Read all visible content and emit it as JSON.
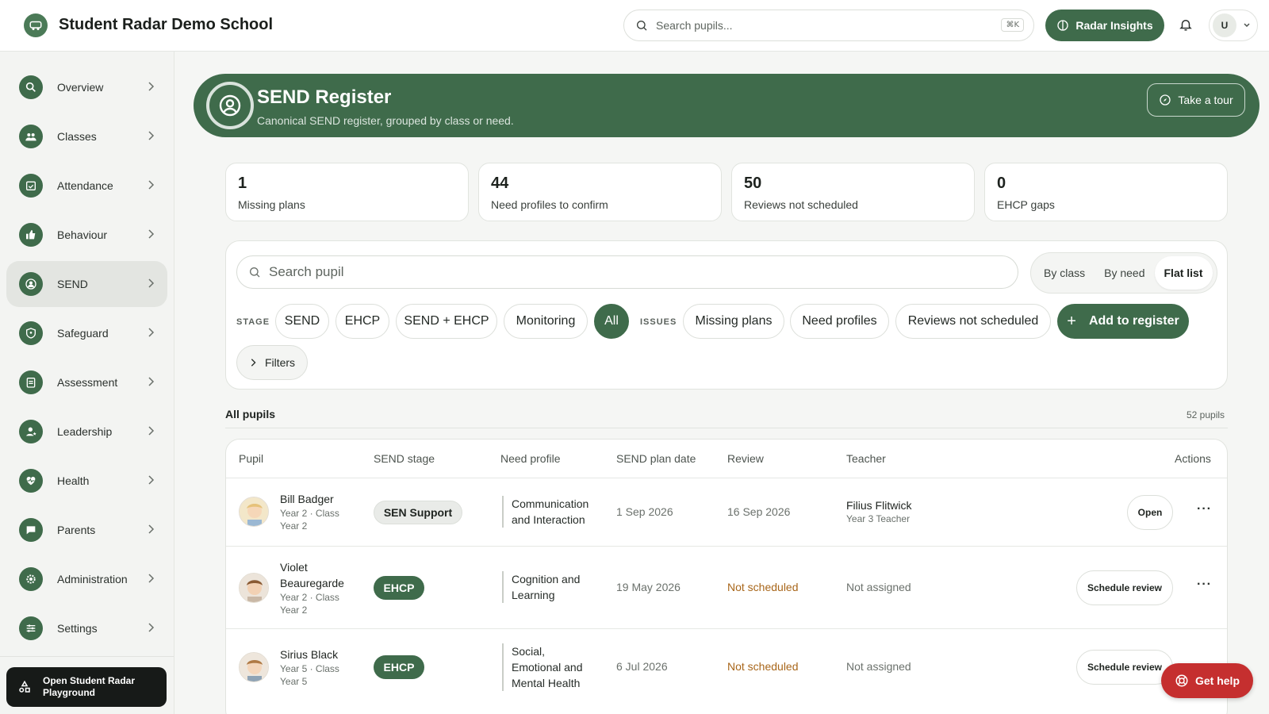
{
  "header": {
    "school_name": "Student Radar Demo School",
    "search_placeholder": "Search pupils...",
    "shortcut": "⌘K",
    "insights_label": "Radar Insights",
    "avatar_initial": "U"
  },
  "sidebar": {
    "items": [
      {
        "label": "Overview",
        "icon": "search-icon"
      },
      {
        "label": "Classes",
        "icon": "users-icon"
      },
      {
        "label": "Attendance",
        "icon": "calendar-check-icon"
      },
      {
        "label": "Behaviour",
        "icon": "thumbs-up-icon"
      },
      {
        "label": "SEND",
        "icon": "user-circle-icon",
        "active": true
      },
      {
        "label": "Safeguard",
        "icon": "shield-icon"
      },
      {
        "label": "Assessment",
        "icon": "clipboard-icon"
      },
      {
        "label": "Leadership",
        "icon": "user-star-icon"
      },
      {
        "label": "Health",
        "icon": "heart-pulse-icon"
      },
      {
        "label": "Parents",
        "icon": "chat-icon"
      },
      {
        "label": "Administration",
        "icon": "gear-icon"
      },
      {
        "label": "Settings",
        "icon": "sliders-icon"
      }
    ],
    "playground_label": "Open Student Radar Playground"
  },
  "banner": {
    "title": "SEND Register",
    "subtitle": "Canonical SEND register, grouped by class or need.",
    "tour_label": "Take a tour"
  },
  "stats": [
    {
      "value": "1",
      "label": "Missing plans"
    },
    {
      "value": "44",
      "label": "Need profiles to confirm"
    },
    {
      "value": "50",
      "label": "Reviews not scheduled"
    },
    {
      "value": "0",
      "label": "EHCP gaps"
    }
  ],
  "filters": {
    "search_placeholder": "Search pupil",
    "views": [
      "By class",
      "By need",
      "Flat list"
    ],
    "selected_view": "Flat list",
    "stage_label": "STAGE",
    "stages": [
      "SEND",
      "EHCP",
      "SEND + EHCP",
      "Monitoring",
      "All"
    ],
    "selected_stage": "All",
    "issues_label": "ISSUES",
    "issues": [
      "Missing plans",
      "Need profiles",
      "Reviews not scheduled"
    ],
    "add_label": "Add to register",
    "filters_label": "Filters"
  },
  "list": {
    "title": "All pupils",
    "count": "52 pupils",
    "columns": [
      "Pupil",
      "SEND stage",
      "Need profile",
      "SEND plan date",
      "Review",
      "Teacher",
      "Actions"
    ],
    "rows": [
      {
        "name": "Bill Badger",
        "meta1": "Year 2 · Class",
        "meta2": "Year 2",
        "stage": "SEN Support",
        "need": "Communication and Interaction",
        "plan_date": "1 Sep 2026",
        "review": "16 Sep 2026",
        "teacher": "Filius Flitwick",
        "teacher_role": "Year 3 Teacher",
        "action": "Open"
      },
      {
        "name": "Violet Beauregarde",
        "meta1": "Year 2 · Class",
        "meta2": "Year 2",
        "stage": "EHCP",
        "need": "Cognition and Learning",
        "plan_date": "19 May 2026",
        "review": "Not scheduled",
        "teacher": "Not assigned",
        "action": "Schedule review"
      },
      {
        "name": "Sirius Black",
        "meta1": "Year 5 · Class",
        "meta2": "Year 5",
        "stage": "EHCP",
        "need": "Social, Emotional and Mental Health",
        "plan_date": "6 Jul 2026",
        "review": "Not scheduled",
        "teacher": "Not assigned",
        "action": "Schedule review"
      }
    ]
  },
  "help_label": "Get help",
  "colors": {
    "brand": "#3f6b4b",
    "warning": "#a8661a",
    "help": "#c52f2f"
  }
}
